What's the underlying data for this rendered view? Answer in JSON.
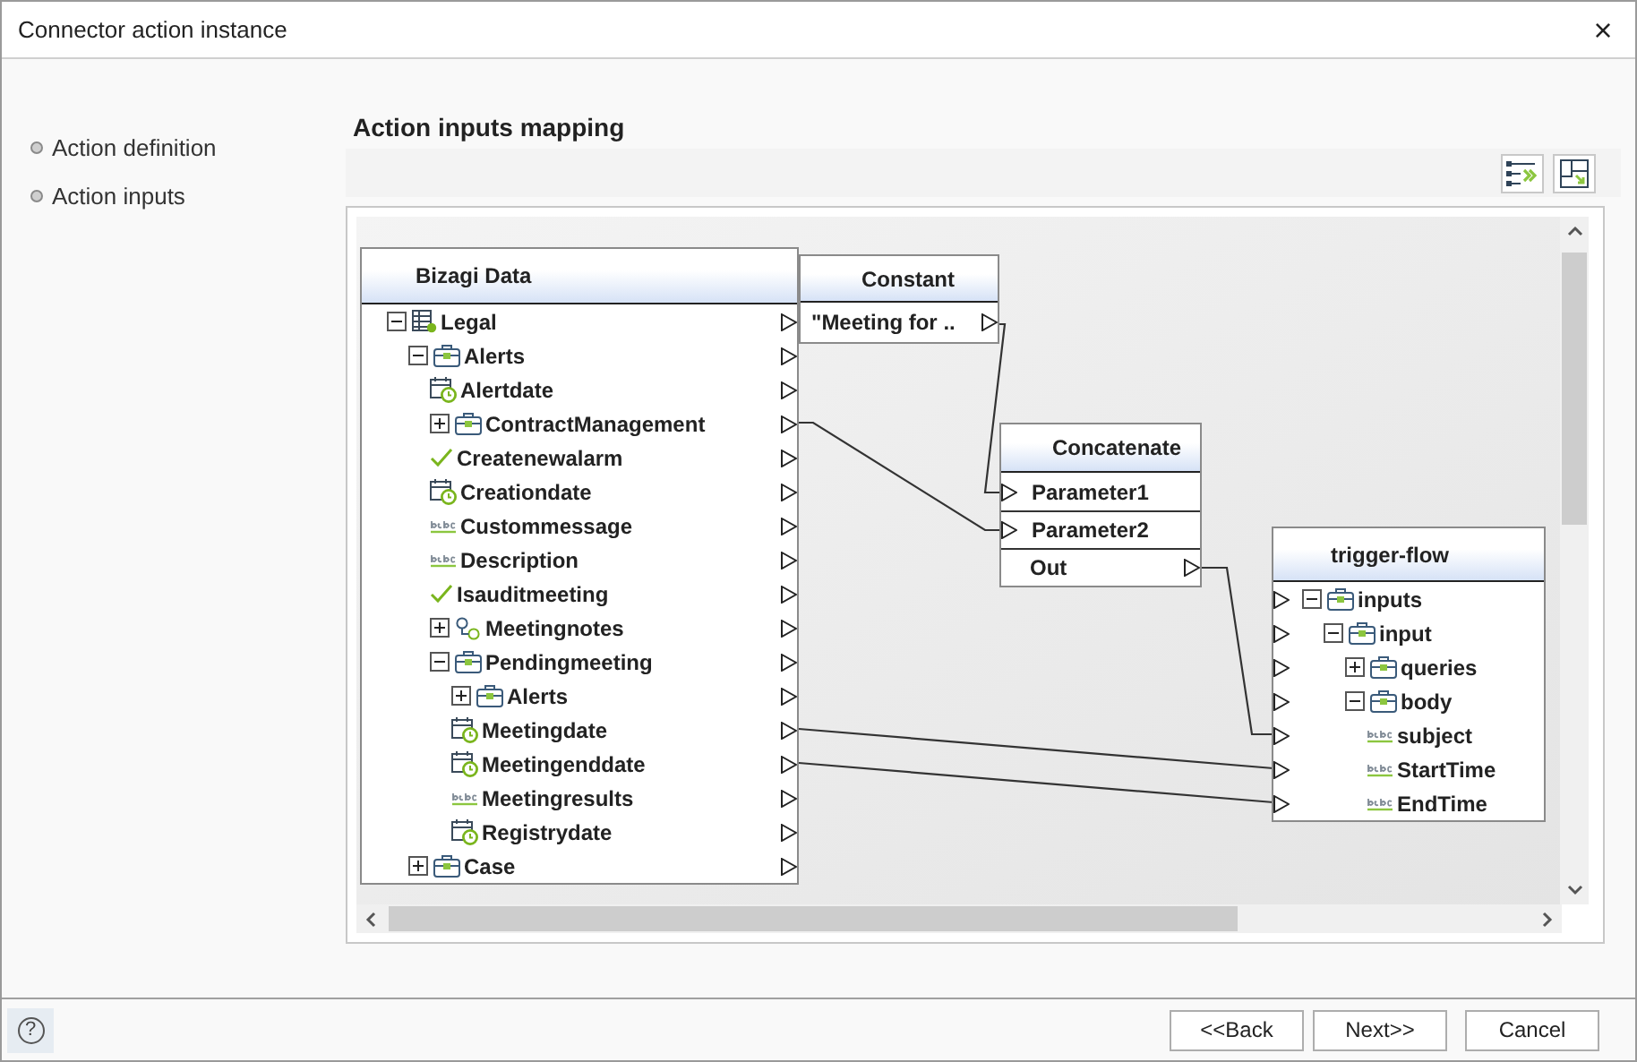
{
  "window": {
    "title": "Connector action instance",
    "close": "×"
  },
  "steps": [
    {
      "label": "Action definition"
    },
    {
      "label": "Action inputs"
    }
  ],
  "section": {
    "title": "Action inputs mapping"
  },
  "nodes": [
    {
      "title": "Bizagi Data",
      "rows": [
        {
          "label": "Legal",
          "kind": "table",
          "expanded": true,
          "children": [
            {
              "label": "Alerts",
              "kind": "entity",
              "expanded": true,
              "children": [
                {
                  "label": "Alertdate",
                  "kind": "date"
                },
                {
                  "label": "ContractManagement",
                  "kind": "entity",
                  "expanded": false
                },
                {
                  "label": "Createnewalarm",
                  "kind": "bool"
                },
                {
                  "label": "Creationdate",
                  "kind": "date"
                },
                {
                  "label": "Custommessage",
                  "kind": "text"
                },
                {
                  "label": "Description",
                  "kind": "text"
                },
                {
                  "label": "Isauditmeeting",
                  "kind": "bool"
                },
                {
                  "label": "Meetingnotes",
                  "kind": "collection",
                  "expanded": false
                },
                {
                  "label": "Pendingmeeting",
                  "kind": "entity",
                  "expanded": true,
                  "children": [
                    {
                      "label": "Alerts",
                      "kind": "entity",
                      "expanded": false
                    },
                    {
                      "label": "Meetingdate",
                      "kind": "date"
                    },
                    {
                      "label": "Meetingenddate",
                      "kind": "date"
                    },
                    {
                      "label": "Meetingresults",
                      "kind": "text"
                    },
                    {
                      "label": "Registrydate",
                      "kind": "date"
                    }
                  ]
                }
              ]
            },
            {
              "label": "Case",
              "kind": "entity",
              "expanded": false
            }
          ]
        }
      ]
    },
    {
      "title": "Constant",
      "rows": [
        {
          "label": "\"Meeting for ..",
          "kind": "result"
        }
      ]
    },
    {
      "title": "Concatenate",
      "rows": [
        {
          "label": "Parameter1",
          "kind": "parameter"
        },
        {
          "label": "Parameter2",
          "kind": "parameter"
        },
        {
          "label": "Out",
          "kind": "result"
        }
      ]
    },
    {
      "title": "trigger-flow",
      "rows": [
        {
          "label": "inputs",
          "kind": "entity",
          "expanded": true,
          "children": [
            {
              "label": "input",
              "kind": "entity",
              "expanded": true,
              "children": [
                {
                  "label": "queries",
                  "kind": "entity",
                  "expanded": false
                },
                {
                  "label": "body",
                  "kind": "entity",
                  "expanded": true,
                  "children": [
                    {
                      "label": "subject",
                      "kind": "text"
                    },
                    {
                      "label": "StartTime",
                      "kind": "text"
                    },
                    {
                      "label": "EndTime",
                      "kind": "text"
                    }
                  ]
                }
              ]
            }
          ]
        }
      ]
    }
  ],
  "footer": {
    "help": "?",
    "buttons": [
      "<<Back",
      "Next>>",
      "Cancel"
    ]
  }
}
